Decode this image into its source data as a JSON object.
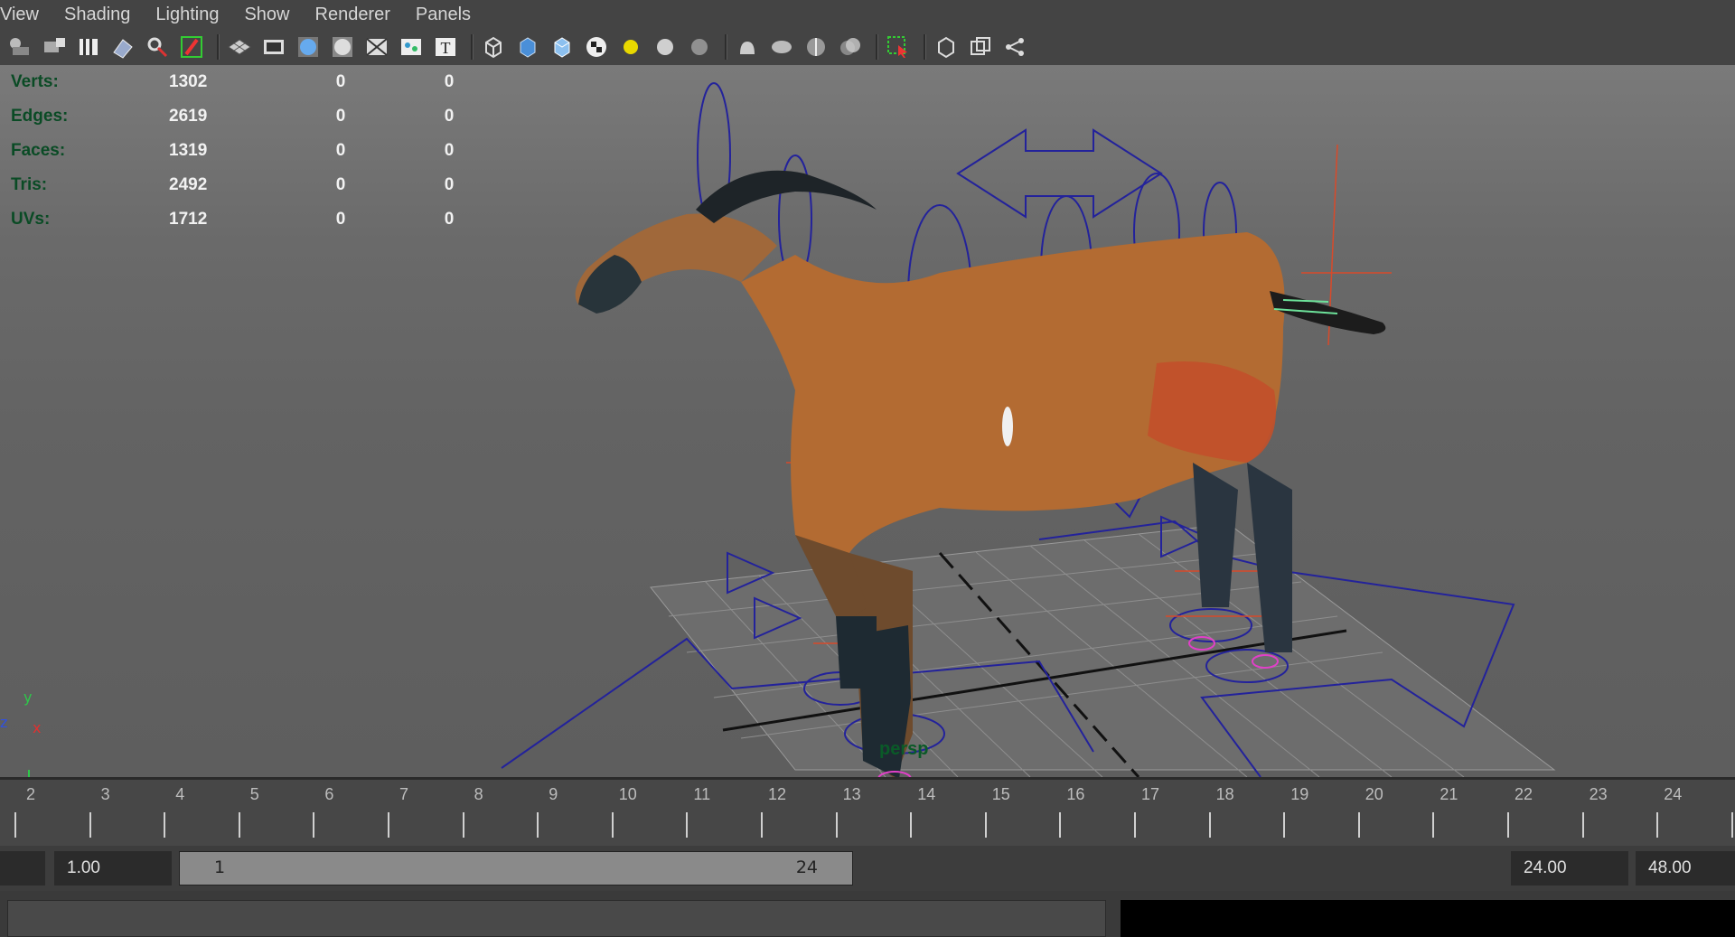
{
  "menu": [
    "View",
    "Shading",
    "Lighting",
    "Show",
    "Renderer",
    "Panels"
  ],
  "toolbar_icons": [
    "select-camera-icon",
    "camera-attributes-icon",
    "bookmarks-icon",
    "image-plane-icon",
    "2d-pan-zoom-icon",
    "grease-pencil-icon",
    "grid-icon",
    "film-gate-icon",
    "resolution-gate-icon",
    "gate-mask-icon",
    "field-chart-icon",
    "safe-action-icon",
    "safe-title-icon",
    "wireframe-icon",
    "smooth-shade-icon",
    "default-material-icon",
    "textured-icon",
    "use-all-lights-icon",
    "shadows-icon",
    "shadows-smooth-icon",
    "screen-space-ao-icon",
    "motion-blur-icon",
    "multisample-aa-icon",
    "depth-of-field-icon",
    "isolate-select-icon",
    "xray-icon",
    "xray-active-icon",
    "xray-joints-icon"
  ],
  "hud": {
    "rows": [
      {
        "label": "Verts:",
        "v1": "1302",
        "v2": "0",
        "v3": "0"
      },
      {
        "label": "Edges:",
        "v1": "2619",
        "v2": "0",
        "v3": "0"
      },
      {
        "label": "Faces:",
        "v1": "1319",
        "v2": "0",
        "v3": "0"
      },
      {
        "label": "Tris:",
        "v1": "2492",
        "v2": "0",
        "v3": "0"
      },
      {
        "label": "UVs:",
        "v1": "1712",
        "v2": "0",
        "v3": "0"
      }
    ]
  },
  "viewport": {
    "camera_label": "persp",
    "axis_y": "y",
    "axis_z": "z",
    "axis_x": "x"
  },
  "timeline": {
    "ticks": [
      "2",
      "3",
      "4",
      "5",
      "6",
      "7",
      "8",
      "9",
      "10",
      "11",
      "12",
      "13",
      "14",
      "15",
      "16",
      "17",
      "18",
      "19",
      "20",
      "21",
      "22",
      "23",
      "24"
    ]
  },
  "range": {
    "start_time": "1.00",
    "slider_start": "1",
    "slider_end": "24",
    "end_time": "24.00",
    "max_time": "48.00"
  }
}
